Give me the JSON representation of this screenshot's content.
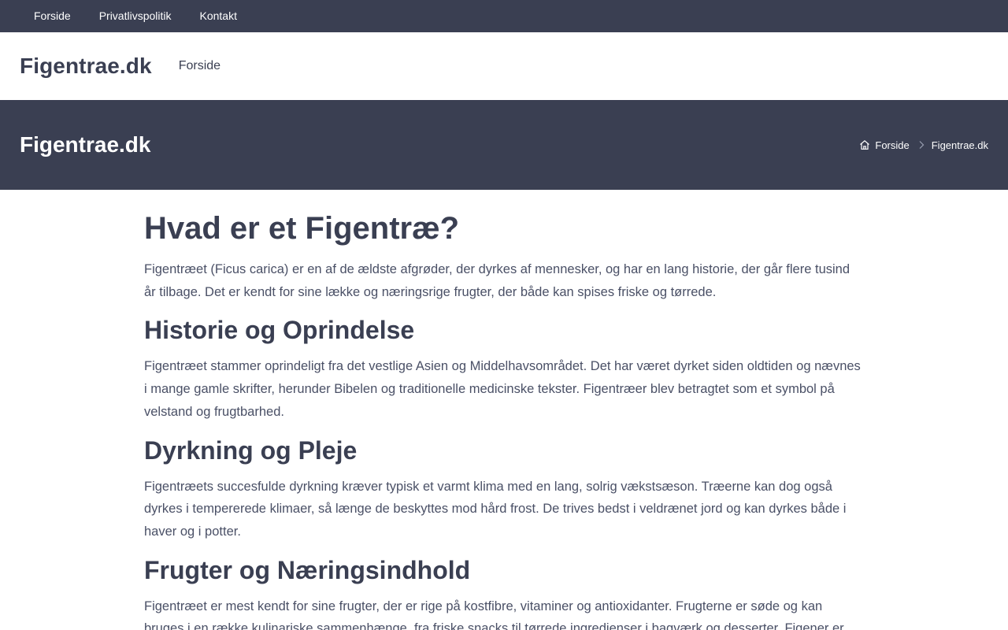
{
  "topbar": {
    "links": [
      "Forside",
      "Privatlivspolitik",
      "Kontakt"
    ]
  },
  "header": {
    "logo": "Figentrae.dk",
    "nav": [
      "Forside"
    ]
  },
  "hero": {
    "title": "Figentrae.dk",
    "breadcrumb": {
      "home_icon": "home-icon",
      "home": "Forside",
      "separator_icon": "chevron-right-icon",
      "current": "Figentrae.dk"
    }
  },
  "article": {
    "title": "Hvad er et Figentræ?",
    "intro": "Figentræet (Ficus carica) er en af de ældste afgrøder, der dyrkes af mennesker, og har en lang historie, der går flere tusind år tilbage. Det er kendt for sine lække og næringsrige frugter, der både kan spises friske og tørrede.",
    "sections": [
      {
        "heading": "Historie og Oprindelse",
        "text": "Figentræet stammer oprindeligt fra det vestlige Asien og Middelhavsområdet. Det har været dyrket siden oldtiden og nævnes i mange gamle skrifter, herunder Bibelen og traditionelle medicinske tekster. Figentræer blev betragtet som et symbol på velstand og frugtbarhed."
      },
      {
        "heading": "Dyrkning og Pleje",
        "text": "Figentræets succesfulde dyrkning kræver typisk et varmt klima med en lang, solrig vækstsæson. Træerne kan dog også dyrkes i tempererede klimaer, så længe de beskyttes mod hård frost. De trives bedst i veldrænet jord og kan dyrkes både i haver og i potter."
      },
      {
        "heading": "Frugter og Næringsindhold",
        "text": "Figentræet er mest kendt for sine frugter, der er rige på kostfibre, vitaminer og antioxidanter. Frugterne er søde og kan bruges i en række kulinariske sammenhænge, fra friske snacks til tørrede ingredienser i bagværk og desserter. Figener er"
      }
    ]
  },
  "colors": {
    "dark": "#3a3f52",
    "text": "#4a5066",
    "background": "#ffffff"
  }
}
